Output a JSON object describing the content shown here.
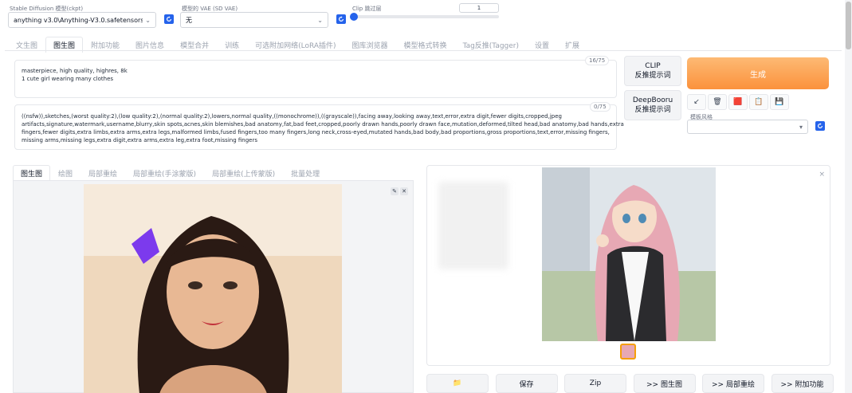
{
  "model": {
    "label": "Stable Diffusion 模型(ckpt)",
    "value": "anything v3.0\\Anything-V3.0.safetensors [10f0bd",
    "chevron_icon": "chevron-down-icon",
    "refresh_icon": "refresh-icon"
  },
  "vae": {
    "label": "模型的 VAE (SD VAE)",
    "value": "无",
    "refresh_icon": "refresh-icon"
  },
  "clip_skip": {
    "label": "Clip 跳过层",
    "value": "1",
    "slider_fraction": 0.0
  },
  "tabs": [
    "文生图",
    "图生图",
    "附加功能",
    "图片信息",
    "模型合并",
    "训练",
    "可选附加网络(LoRA插件)",
    "图库浏览器",
    "模型格式转换",
    "Tag反推(Tagger)",
    "设置",
    "扩展"
  ],
  "active_tab": 1,
  "prompt": {
    "line1": "masterpiece, high quality, highres, 8k",
    "line2": "1 cute girl wearing many clothes",
    "counter": "16/75"
  },
  "negative_prompt": {
    "line1": "((nsfw)),sketches,(worst quality:2),(low quality:2),(normal quality:2),lowers,normal quality,((monochrome)),((grayscale)),facing away,looking away,text,error,extra digit,fewer digits,cropped,jpeg",
    "line2": "artifacts,signature,watermark,username,blurry,skin spots,acnes,skin blemishes,bad anatomy,fat,bad feet,cropped,poorly drawn hands,poorly drawn face,mutation,deformed,tilted head,bad anatomy,bad hands,extra",
    "line3": "fingers,fewer digits,extra limbs,extra arms,extra legs,malformed limbs,fused fingers,too many fingers,long neck,cross-eyed,mutated hands,bad body,bad proportions,gross proportions,text,error,missing fingers,",
    "line4": "missing arms,missing legs,extra digit,extra arms,extra leg,extra foot,missing fingers",
    "counter": "0/75"
  },
  "clip_button": {
    "line1": "CLIP",
    "line2": "反推提示词"
  },
  "deepbooru_button": {
    "line1": "DeepBooru",
    "line2": "反推提示词"
  },
  "generate_label": "生成",
  "tools": [
    {
      "name": "arrow-icon",
      "glyph": "↙"
    },
    {
      "name": "trash-icon",
      "glyph": "🗑"
    },
    {
      "name": "red-card-icon",
      "glyph": "🟥"
    },
    {
      "name": "clipboard-icon",
      "glyph": "📋"
    },
    {
      "name": "save-icon",
      "glyph": "💾"
    }
  ],
  "style": {
    "label": "模板风格",
    "value": ""
  },
  "subtabs": [
    "图生图",
    "绘图",
    "局部重绘",
    "局部重绘(手涂蒙版)",
    "局部重绘(上传蒙版)",
    "批量处理"
  ],
  "active_subtab": 0,
  "bottom_buttons": [
    "📁",
    "保存",
    "Zip",
    ">> 图生图",
    ">> 局部重绘",
    ">> 附加功能"
  ],
  "colors": {
    "accent": "#2563eb",
    "generate": "#fb923c"
  }
}
